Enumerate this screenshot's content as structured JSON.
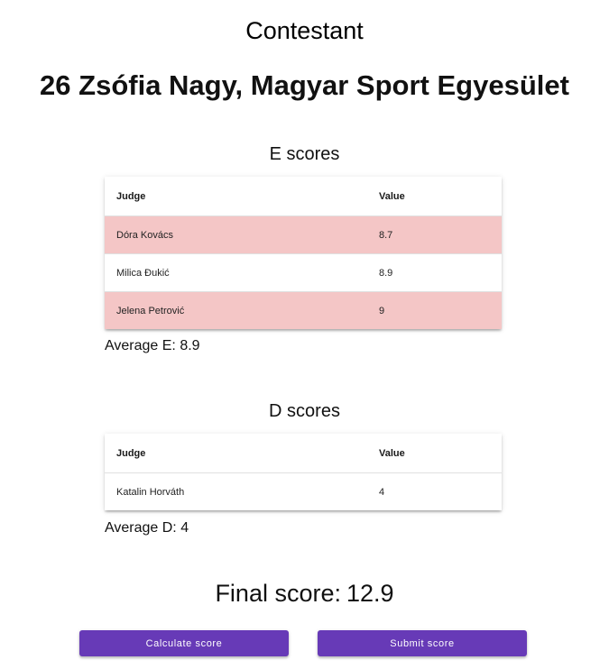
{
  "header": {
    "label": "Contestant",
    "contestant": "26 Zsófia Nagy, Magyar Sport Egyesület"
  },
  "e_scores": {
    "title": "E scores",
    "columns": {
      "judge": "Judge",
      "value": "Value"
    },
    "rows": [
      {
        "judge": "Dóra Kovács",
        "value": "8.7",
        "highlighted": true
      },
      {
        "judge": "Milica Đukić",
        "value": "8.9",
        "highlighted": false
      },
      {
        "judge": "Jelena Petrović",
        "value": "9",
        "highlighted": true
      }
    ],
    "average": "Average E: 8.9"
  },
  "d_scores": {
    "title": "D scores",
    "columns": {
      "judge": "Judge",
      "value": "Value"
    },
    "rows": [
      {
        "judge": "Katalin Horváth",
        "value": "4",
        "highlighted": false
      }
    ],
    "average": "Average D: 4"
  },
  "final": {
    "label": "Final score:",
    "value": "12.9"
  },
  "buttons": {
    "calculate": "Calculate score",
    "submit": "Submit score"
  },
  "colors": {
    "primary": "#673ab7",
    "highlight_row": "#f4c6c6"
  }
}
